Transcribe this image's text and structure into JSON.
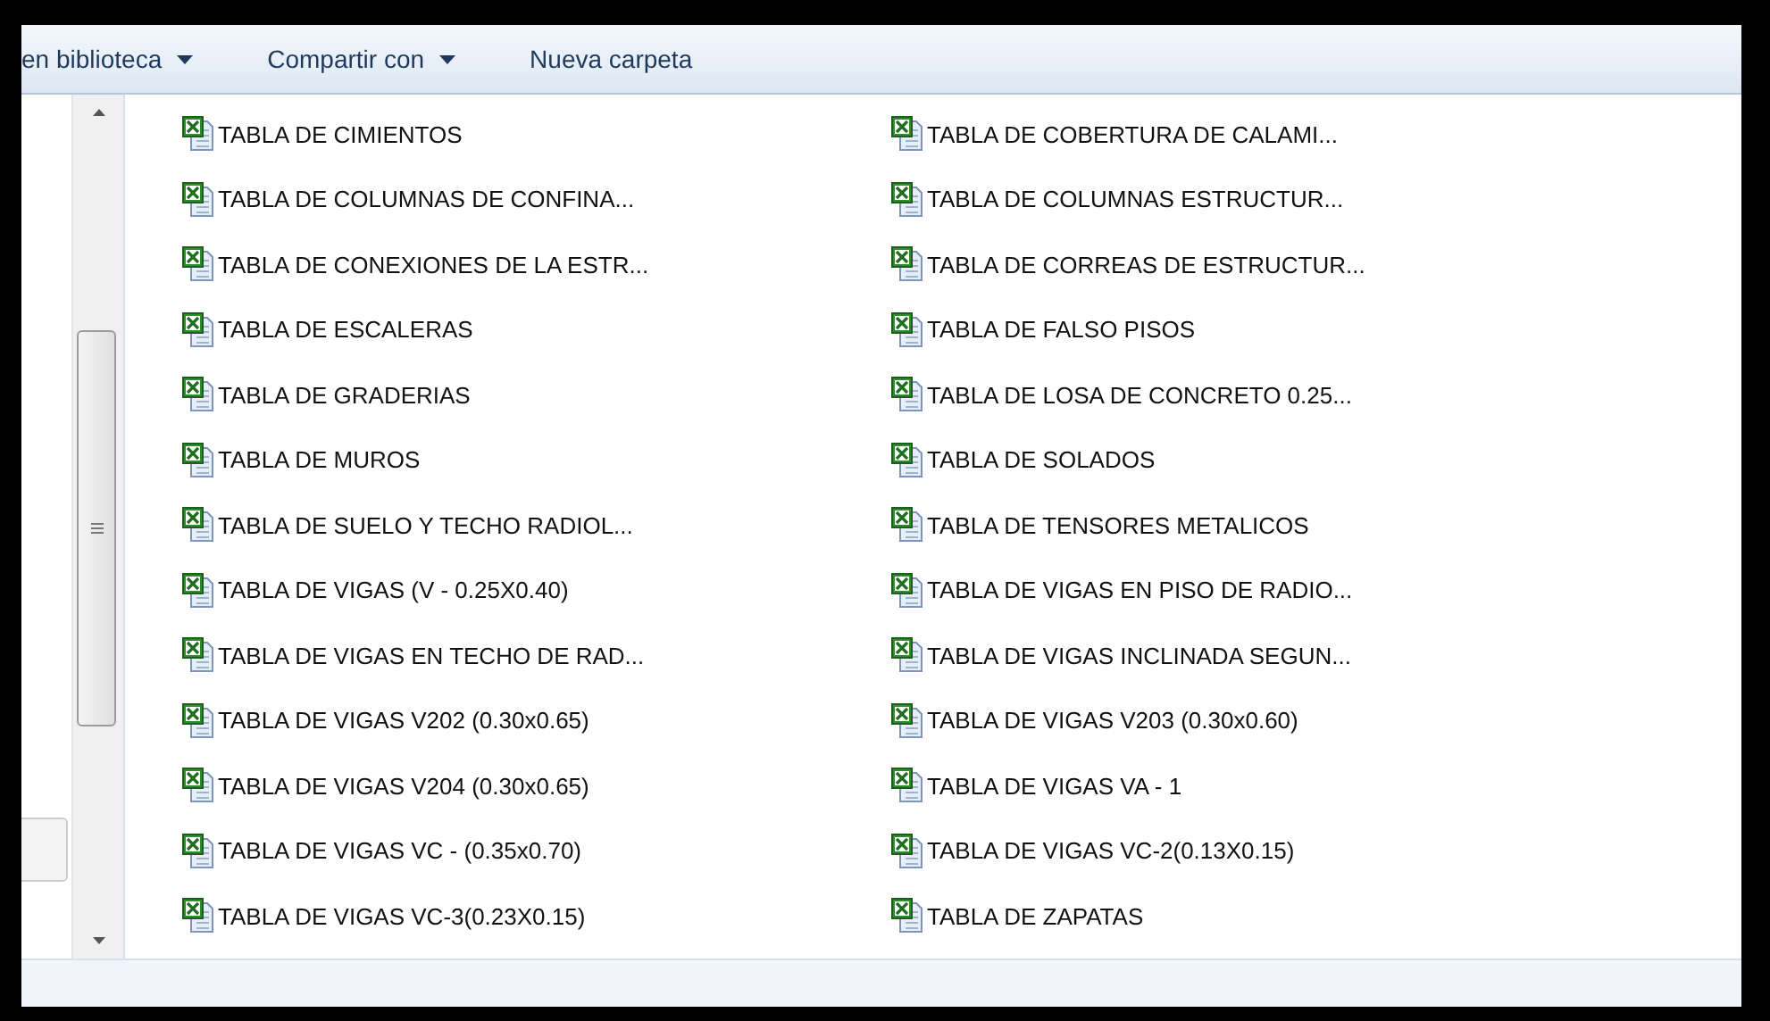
{
  "toolbar": [
    {
      "label": "en biblioteca",
      "dropdown": true
    },
    {
      "label": "Compartir con",
      "dropdown": true
    },
    {
      "label": "Nueva carpeta",
      "dropdown": false
    }
  ],
  "files": [
    {
      "name": "TABLA DE CIMIENTOS"
    },
    {
      "name": "TABLA DE COLUMNAS DE CONFINA..."
    },
    {
      "name": "TABLA DE CONEXIONES DE LA ESTR..."
    },
    {
      "name": "TABLA DE ESCALERAS"
    },
    {
      "name": "TABLA DE GRADERIAS"
    },
    {
      "name": "TABLA DE MUROS"
    },
    {
      "name": "TABLA DE SUELO Y TECHO RADIOL..."
    },
    {
      "name": "TABLA DE VIGAS (V - 0.25X0.40)"
    },
    {
      "name": "TABLA DE VIGAS EN TECHO DE RAD..."
    },
    {
      "name": "TABLA DE VIGAS V202 (0.30x0.65)"
    },
    {
      "name": "TABLA DE VIGAS V204 (0.30x0.65)"
    },
    {
      "name": "TABLA DE VIGAS VC -  (0.35x0.70)"
    },
    {
      "name": "TABLA DE VIGAS VC-3(0.23X0.15)"
    },
    {
      "name": "TABLA DE COBERTURA DE CALAMI..."
    },
    {
      "name": "TABLA DE COLUMNAS ESTRUCTUR..."
    },
    {
      "name": "TABLA DE CORREAS DE ESTRUCTUR..."
    },
    {
      "name": "TABLA DE FALSO PISOS"
    },
    {
      "name": "TABLA DE LOSA DE CONCRETO 0.25..."
    },
    {
      "name": "TABLA DE SOLADOS"
    },
    {
      "name": "TABLA DE TENSORES METALICOS"
    },
    {
      "name": "TABLA DE VIGAS EN PISO DE RADIO..."
    },
    {
      "name": "TABLA DE VIGAS INCLINADA SEGUN..."
    },
    {
      "name": "TABLA DE VIGAS V203 (0.30x0.60)"
    },
    {
      "name": "TABLA DE VIGAS VA - 1"
    },
    {
      "name": "TABLA DE VIGAS VC-2(0.13X0.15)"
    },
    {
      "name": "TABLA DE ZAPATAS"
    }
  ]
}
